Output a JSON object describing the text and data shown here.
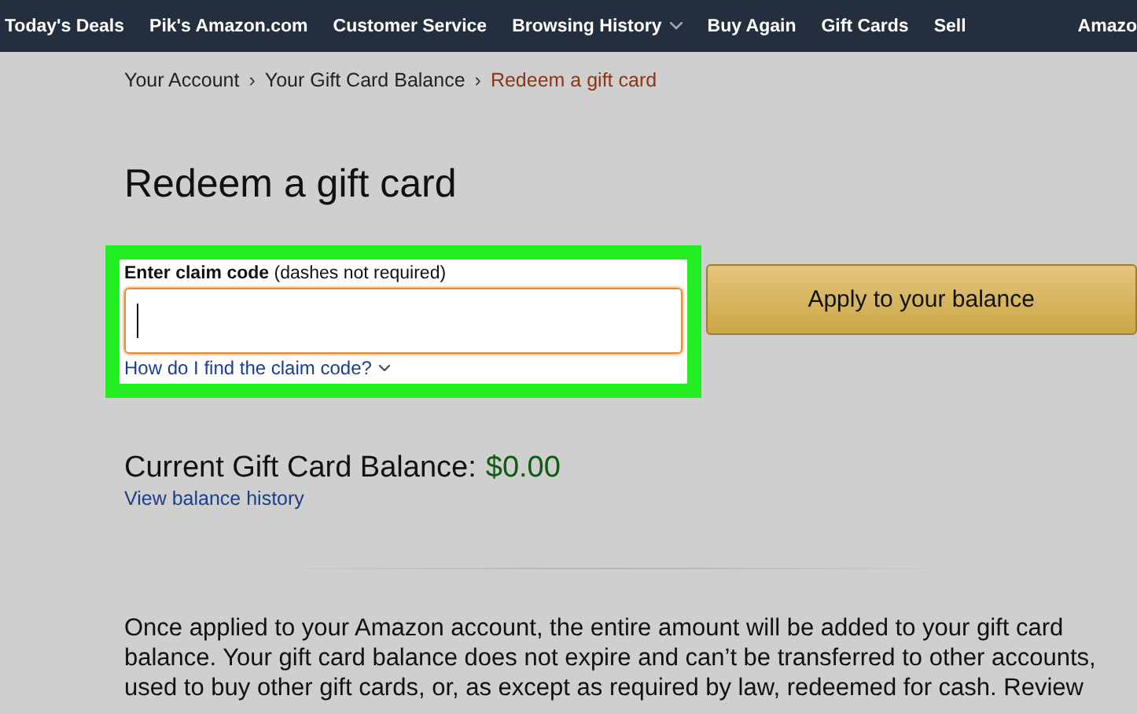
{
  "nav": {
    "items": [
      {
        "label": "Today's Deals",
        "dropdown": false
      },
      {
        "label": "Pik's Amazon.com",
        "dropdown": false
      },
      {
        "label": "Customer Service",
        "dropdown": false
      },
      {
        "label": "Browsing History",
        "dropdown": true
      },
      {
        "label": "Buy Again",
        "dropdown": false
      },
      {
        "label": "Gift Cards",
        "dropdown": false
      },
      {
        "label": "Sell",
        "dropdown": false
      }
    ],
    "edge_text": "Amazo"
  },
  "breadcrumb": [
    {
      "label": "Your Account",
      "current": false
    },
    {
      "label": "Your Gift Card Balance",
      "current": false
    },
    {
      "label": "Redeem a gift card",
      "current": true
    }
  ],
  "breadcrumb_separator": "›",
  "title": "Redeem a gift card",
  "claim_form": {
    "label": "**Enter claim code** (dashes not required)",
    "focused": true,
    "highlighted": true,
    "help_link": "How do I find the claim code?",
    "button": "Apply to your balance"
  },
  "balance": {
    "label": "Current Gift Card Balance:",
    "amount": "$0.00",
    "history_link": "View balance history"
  },
  "paragraph": "Once applied to your Amazon account, the entire amount will be added to your gift card balance. Your gift card balance does not expire and can’t be transferred to other accounts, used to buy other gift cards, or, as except as required by law, redeemed for cash. Review"
}
